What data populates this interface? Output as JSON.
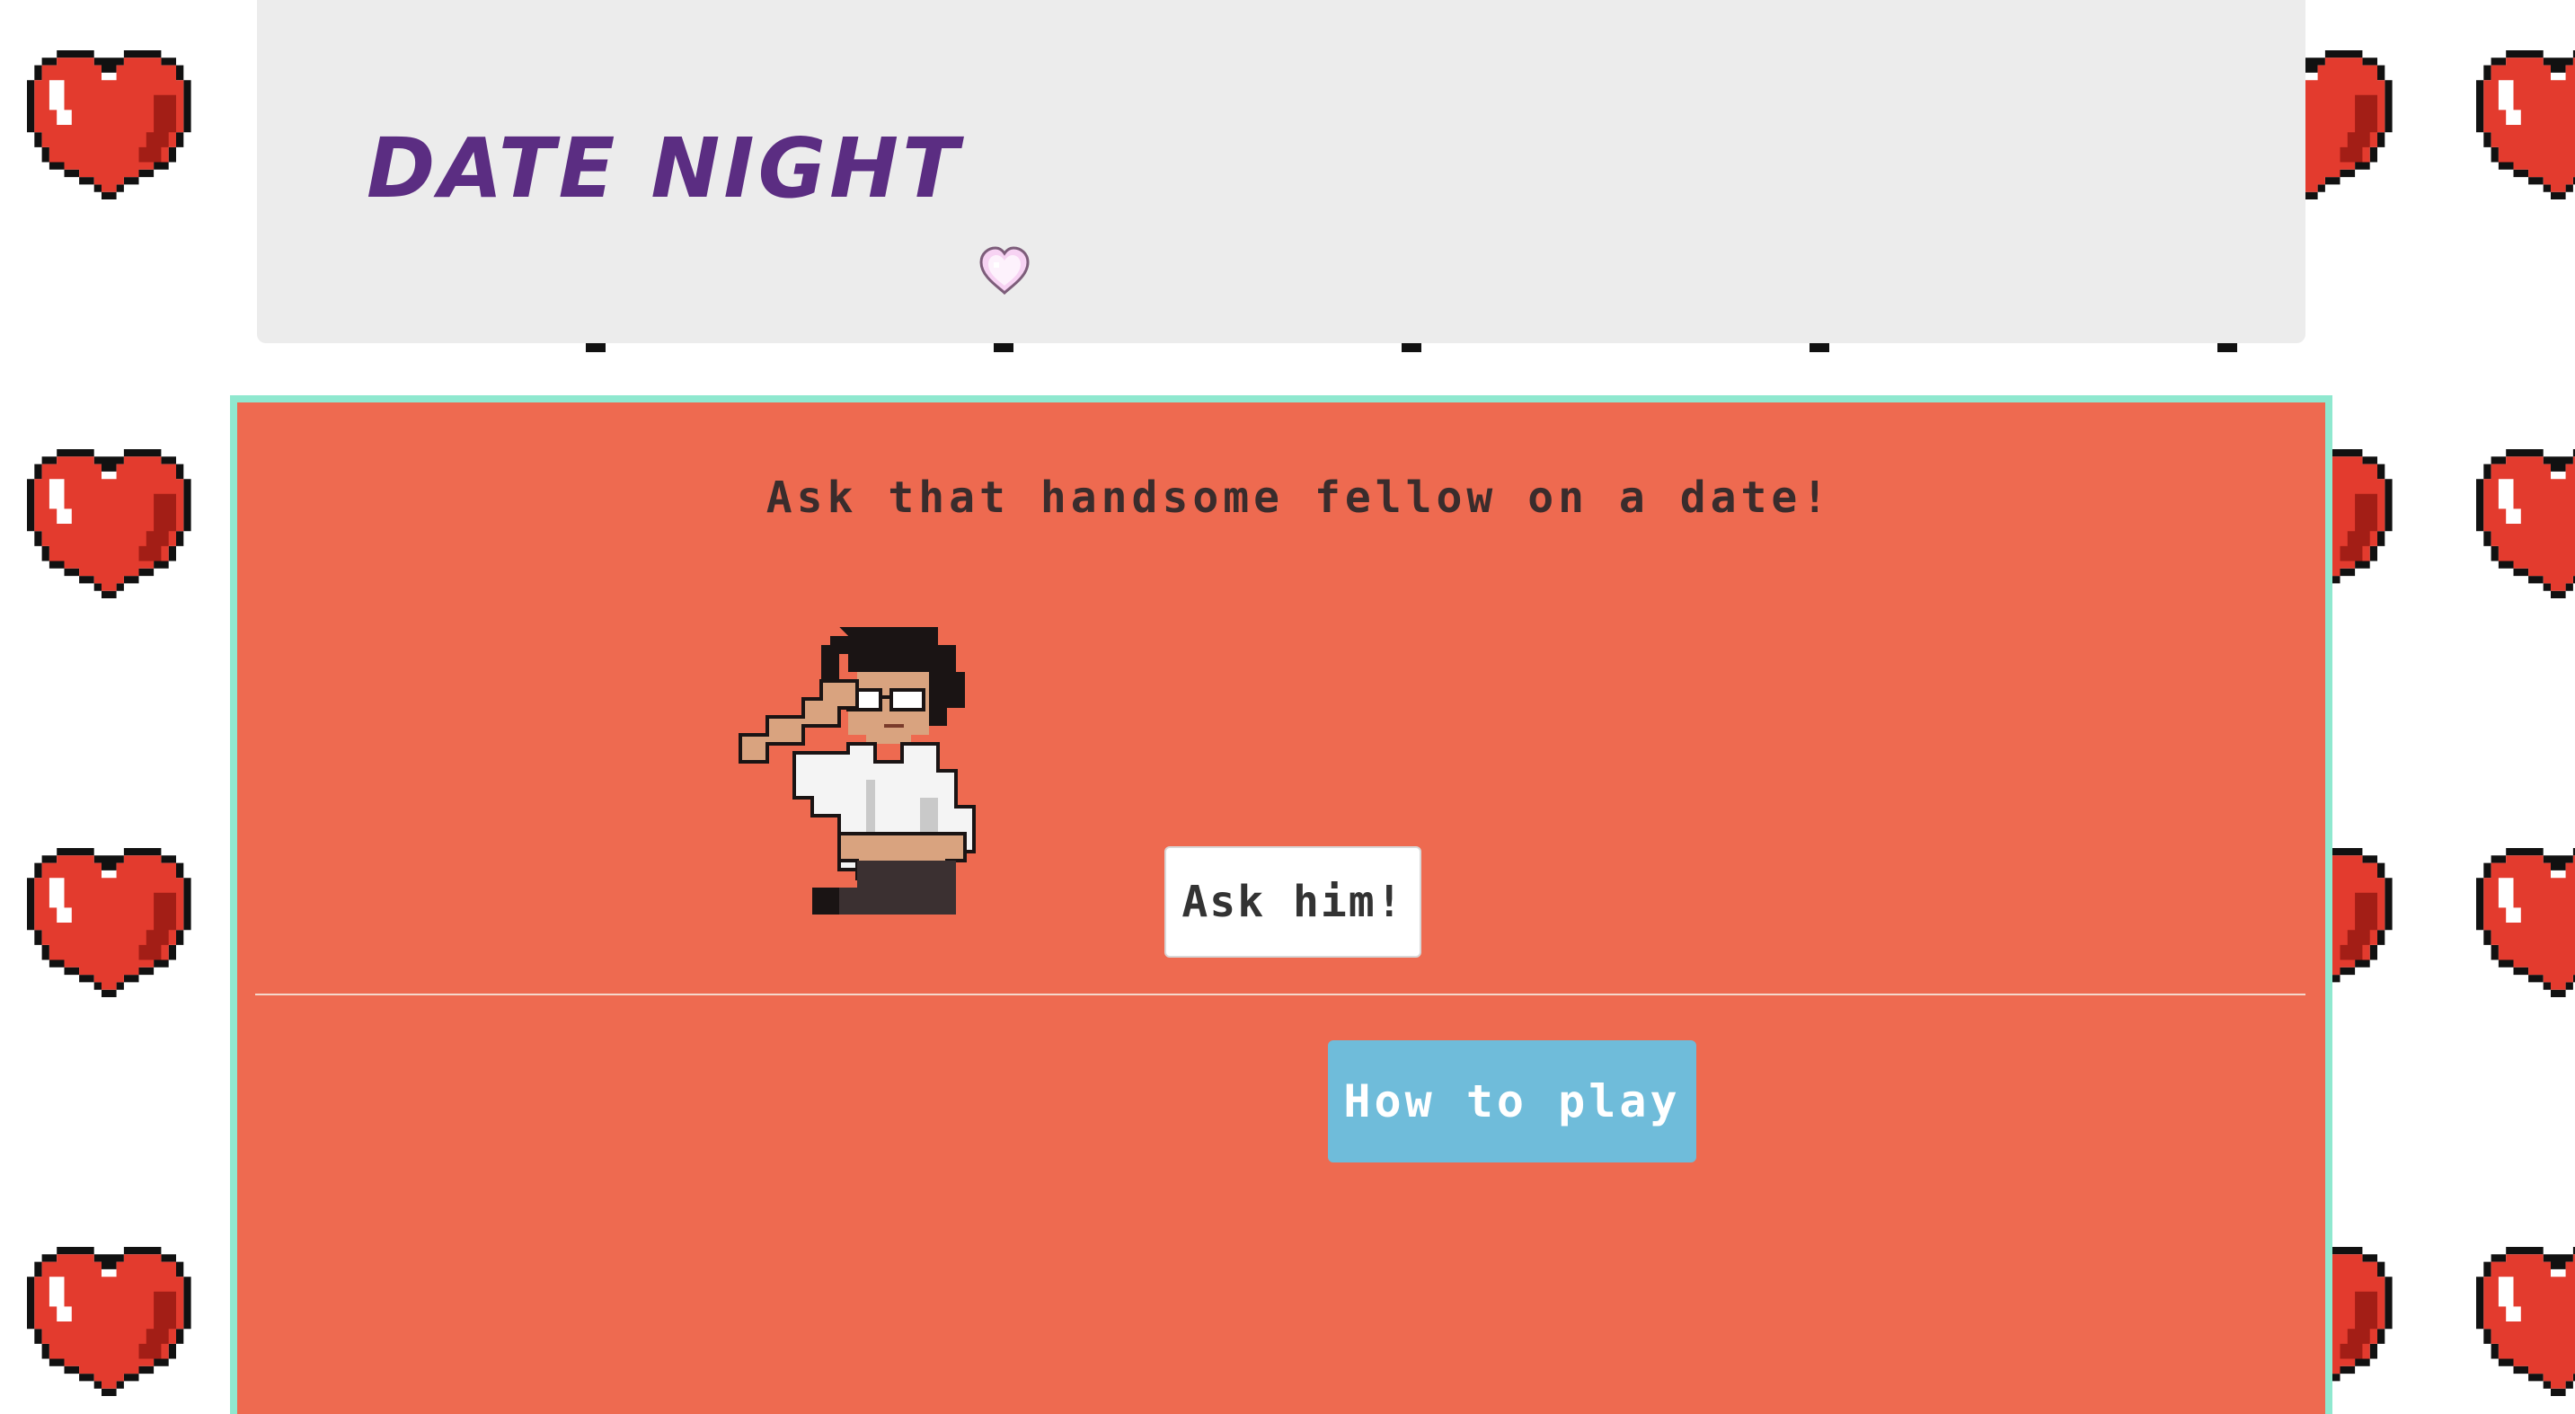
{
  "header": {
    "title": "Date Night"
  },
  "main": {
    "prompt": "Ask that handsome fellow on a date!",
    "ask_button_label": "Ask him!",
    "howto_button_label": "How to play"
  },
  "icons": {
    "background": "pixel-heart-icon",
    "cursor": "heart-cursor-icon",
    "character": "pixel-man-character"
  },
  "colors": {
    "title": "#5b2d82",
    "panel": "#ee6a50",
    "panel_border": "#8fe8cf",
    "header_bg": "#ececec",
    "howto_button": "#6fbcda",
    "heart_red": "#e33b2e",
    "heart_outline": "#111111"
  }
}
